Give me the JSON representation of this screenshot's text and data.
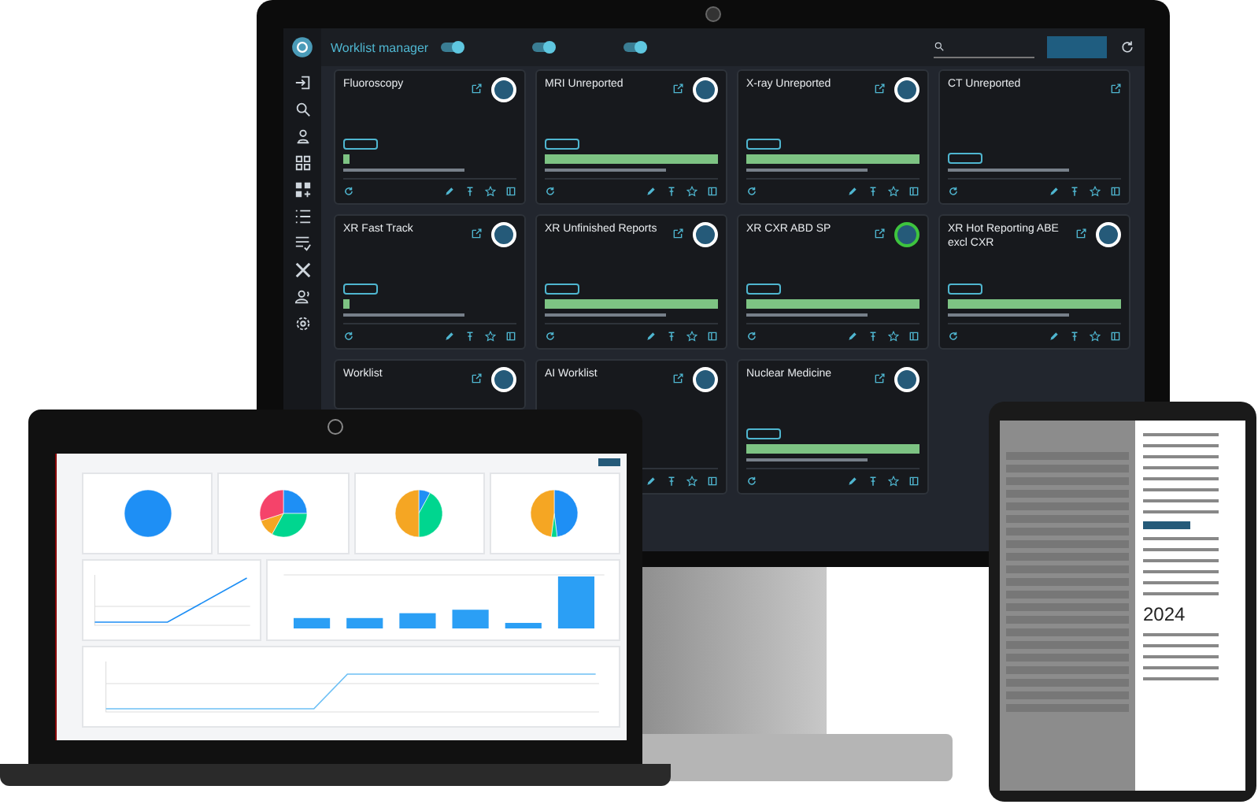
{
  "monitor": {
    "app_title": "Worklist manager",
    "toggles": [
      {
        "on": true
      },
      {
        "on": true
      },
      {
        "on": true
      }
    ],
    "cards": [
      {
        "title": "Fluoroscopy",
        "level": 0.03,
        "color": "#ffffff"
      },
      {
        "title": "MRI Unreported",
        "level": 1,
        "color": "#ffffff"
      },
      {
        "title": "X-ray Unreported",
        "level": 1,
        "color": "#ffffff"
      },
      {
        "title": "CT Unreported"
      },
      {
        "title": "XR Fast Track",
        "level": 0.03,
        "color": "#ffffff"
      },
      {
        "title": "XR Unfinished Reports",
        "level": 1,
        "color": "#ffffff"
      },
      {
        "title": "XR CXR ABD SP",
        "level": 1,
        "color": "#3ec43e"
      },
      {
        "title": "XR Hot Reporting ABE excl CXR",
        "level": 1,
        "color": "#ffffff"
      },
      {
        "title": "Worklist",
        "color": "#ffffff"
      },
      {
        "title": "AI Worklist",
        "color": "#ffffff"
      },
      {
        "title": "Nuclear Medicine",
        "level": 1,
        "color": "#ffffff"
      }
    ]
  },
  "tablet": {
    "year": "2024"
  }
}
